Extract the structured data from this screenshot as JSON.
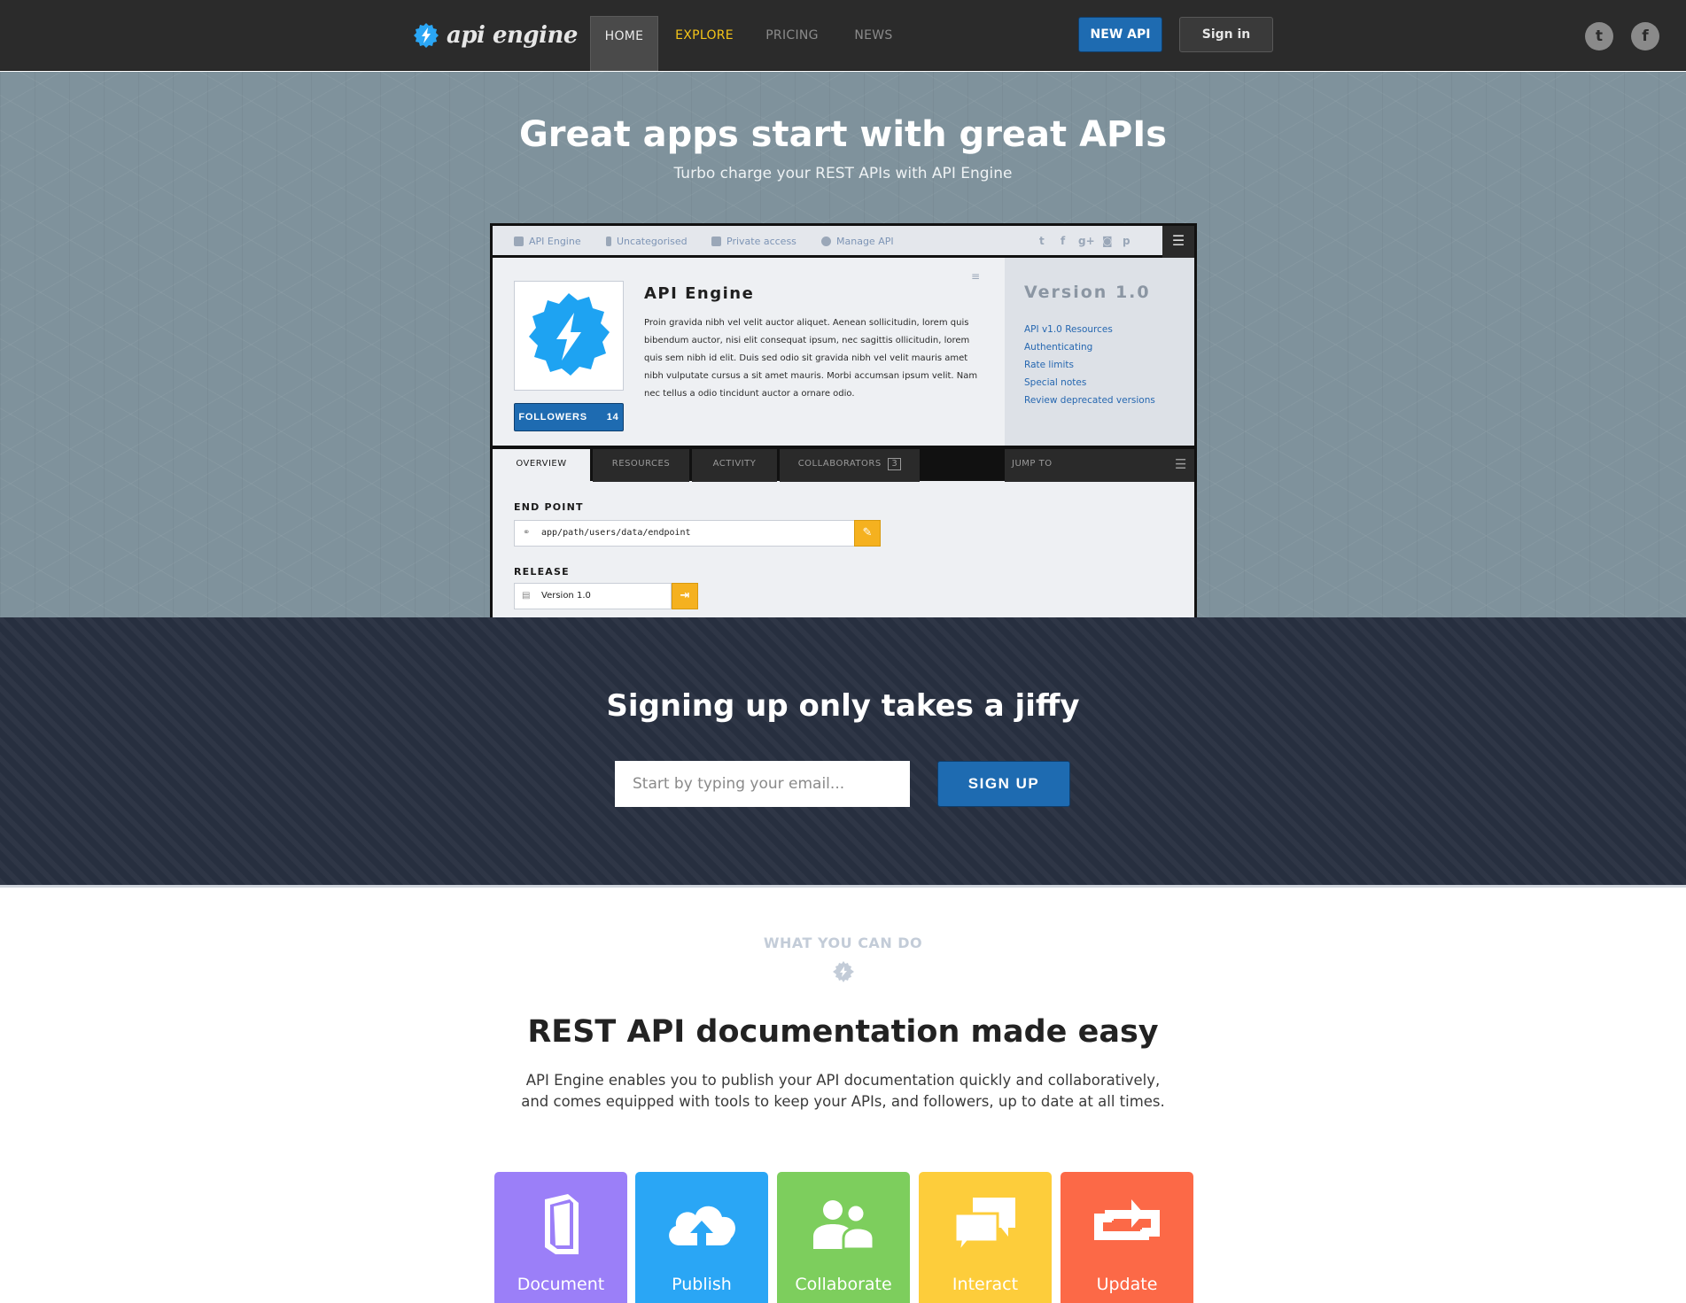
{
  "nav": {
    "logo_text": "api engine",
    "items": [
      {
        "label": "HOME"
      },
      {
        "label": "EXPLORE"
      },
      {
        "label": "PRICING"
      },
      {
        "label": "NEWS"
      }
    ],
    "new_api_label": "NEW API",
    "sign_in_label": "Sign in",
    "social": [
      "twitter-icon",
      "facebook-icon"
    ]
  },
  "hero": {
    "title": "Great apps start with great APIs",
    "subtitle": "Turbo charge your REST APIs with API Engine"
  },
  "mock": {
    "bar_items": [
      "API Engine",
      "Uncategorised",
      "Private access",
      "Manage API"
    ],
    "api_name": "API Engine",
    "description": "Proin gravida nibh vel velit auctor aliquet. Aenean sollicitudin, lorem quis bibendum auctor, nisi elit consequat ipsum, nec sagittis ollicitudin, lorem quis sem nibh id elit. Duis sed odio sit gravida nibh vel velit mauris amet nibh vulputate cursus a sit amet mauris. Morbi accumsan ipsum velit. Nam nec tellus a odio tincidunt auctor a ornare odio.",
    "followers_label": "FOLLOWERS",
    "followers_count": "14",
    "version": "Version 1.0",
    "version_links": [
      "API v1.0 Resources",
      "Authenticating",
      "Rate limits",
      "Special notes",
      "Review deprecated versions"
    ],
    "tabs": [
      {
        "label": "OVERVIEW"
      },
      {
        "label": "RESOURCES"
      },
      {
        "label": "ACTIVITY"
      },
      {
        "label": "COLLABORATORS",
        "badge": "3"
      }
    ],
    "jump_to": "JUMP TO",
    "endpoint_label": "END POINT",
    "endpoint_value": "app/path/users/data/endpoint",
    "release_label": "RELEASE",
    "release_value": "Version 1.0"
  },
  "signup": {
    "title": "Signing up only takes a jiffy",
    "email_placeholder": "Start by typing your email...",
    "button_label": "SIGN UP"
  },
  "features": {
    "kicker": "WHAT YOU CAN DO",
    "title": "REST API documentation made easy",
    "line1": "API Engine enables you to publish your API documentation quickly and collaboratively,",
    "line2": "and comes equipped with tools to keep your APIs, and followers, up to date at all times.",
    "tiles": [
      {
        "label": "Document",
        "color": "#9b7ff8",
        "icon": "book-icon"
      },
      {
        "label": "Publish",
        "color": "#2aa6f5",
        "icon": "cloud-upload-icon"
      },
      {
        "label": "Collaborate",
        "color": "#7dce5d",
        "icon": "users-icon"
      },
      {
        "label": "Interact",
        "color": "#fdcd3b",
        "icon": "chat-icon"
      },
      {
        "label": "Update",
        "color": "#fc6947",
        "icon": "refresh-icon"
      }
    ]
  },
  "colors": {
    "accent_blue": "#1e6bb1",
    "accent_yellow": "#f5c518",
    "dark": "#2b2b2b"
  }
}
